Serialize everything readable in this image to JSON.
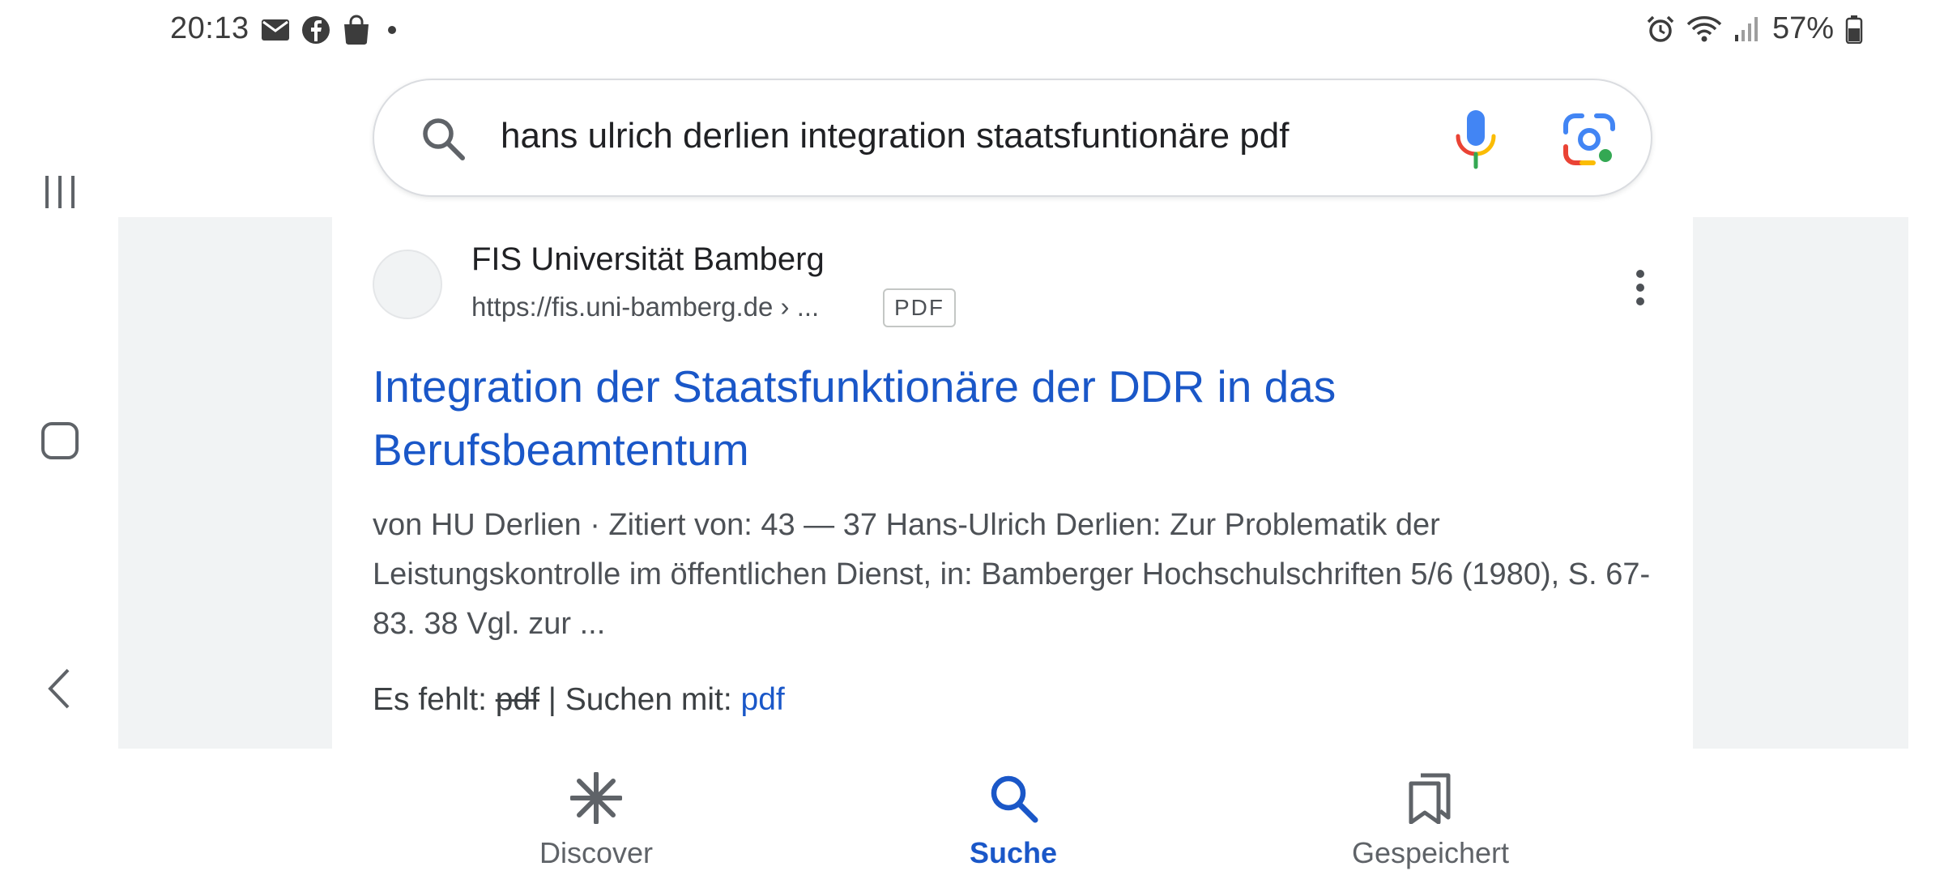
{
  "status_bar": {
    "time": "20:13",
    "left_icons": [
      "mail-icon",
      "facebook-icon",
      "shopping-bag-icon",
      "dot-icon"
    ],
    "right_icons": [
      "alarm-icon",
      "wifi-icon",
      "signal-icon",
      "battery-icon"
    ],
    "battery": "57%"
  },
  "search": {
    "query": "hans ulrich derlien integration staatsfuntionäre pdf"
  },
  "result": {
    "site_name": "FIS Universität Bamberg",
    "url": "https://fis.uni-bamberg.de › ...",
    "badge": "PDF",
    "title": "Integration der Staatsfunktionäre der DDR in das Berufsbeamtentum",
    "snippet": "von HU Derlien · Zitiert von: 43 — 37 Hans-Ulrich Derlien: Zur Problematik der Leistungskontrolle im öffentlichen Dienst, in: Bamberger Hochschulschriften 5/6 (1980), S. 67-83. 38 Vgl. zur ...",
    "missing_prefix": "Es fehlt: ",
    "missing_term": "pdf",
    "search_with_prefix": " | Suchen mit: ",
    "search_with_term": "pdf"
  },
  "bottom_nav": {
    "items": [
      {
        "label": "Discover",
        "icon": "discover-icon",
        "active": false
      },
      {
        "label": "Suche",
        "icon": "search-icon",
        "active": true
      },
      {
        "label": "Gespeichert",
        "icon": "bookmarks-icon",
        "active": false
      }
    ]
  },
  "colors": {
    "link_blue": "#1a57c8",
    "background_gray": "#f1f3f4",
    "text_secondary": "#4d5156"
  }
}
